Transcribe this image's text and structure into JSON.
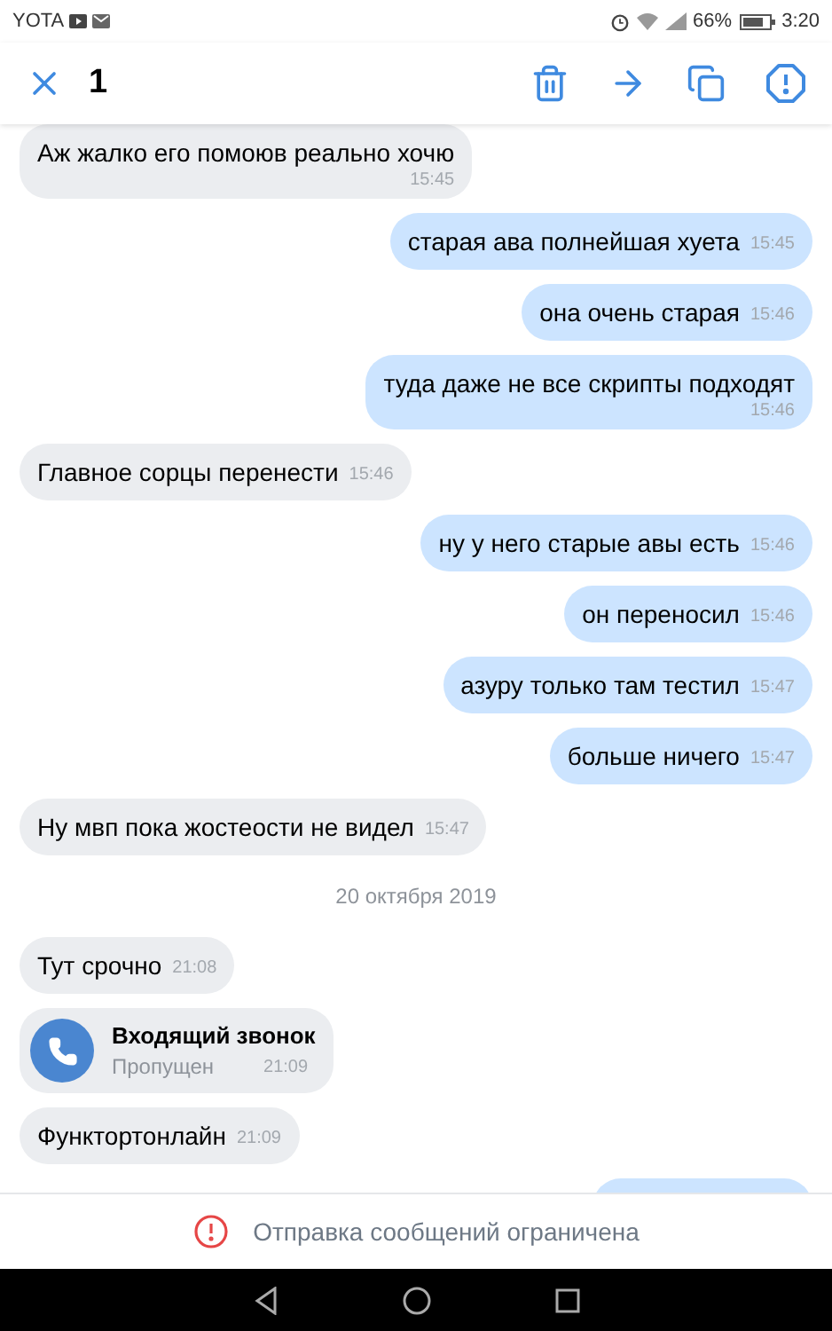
{
  "status_bar": {
    "carrier": "YOTA",
    "battery": "66%",
    "time": "3:20"
  },
  "header": {
    "selected_count": "1"
  },
  "messages": [
    {
      "kind": "text",
      "outgoing": false,
      "text": "Аж жалко его помоюв реально хочю",
      "time": "15:45",
      "time_below": true
    },
    {
      "kind": "text",
      "outgoing": true,
      "text": "старая ава полнейшая хуета",
      "time": "15:45",
      "time_below": false
    },
    {
      "kind": "text",
      "outgoing": true,
      "text": "она очень старая",
      "time": "15:46",
      "time_below": false
    },
    {
      "kind": "text",
      "outgoing": true,
      "text": "туда даже не все скрипты подходят",
      "time": "15:46",
      "time_below": true
    },
    {
      "kind": "text",
      "outgoing": false,
      "text": "Главное сорцы перенести",
      "time": "15:46",
      "time_below": false
    },
    {
      "kind": "text",
      "outgoing": true,
      "text": "ну у него старые авы есть",
      "time": "15:46",
      "time_below": false
    },
    {
      "kind": "text",
      "outgoing": true,
      "text": "он переносил",
      "time": "15:46",
      "time_below": false
    },
    {
      "kind": "text",
      "outgoing": true,
      "text": "азуру только там тестил",
      "time": "15:47",
      "time_below": false
    },
    {
      "kind": "text",
      "outgoing": true,
      "text": "больше ничего",
      "time": "15:47",
      "time_below": false
    },
    {
      "kind": "text",
      "outgoing": false,
      "text": "Ну мвп пока жостеости не видел",
      "time": "15:47",
      "time_below": false
    },
    {
      "kind": "date",
      "text": "20 октября 2019"
    },
    {
      "kind": "text",
      "outgoing": false,
      "text": "Тут срочно",
      "time": "21:08",
      "time_below": false
    },
    {
      "kind": "call",
      "outgoing": false,
      "title": "Входящий звонок",
      "status": "Пропущен",
      "time": "21:09"
    },
    {
      "kind": "text",
      "outgoing": false,
      "text": "Функтортонлайн",
      "time": "21:09",
      "time_below": false
    },
    {
      "kind": "hidden",
      "outgoing": true
    }
  ],
  "footer": {
    "notice": "Отправка сообщений ограничена"
  }
}
